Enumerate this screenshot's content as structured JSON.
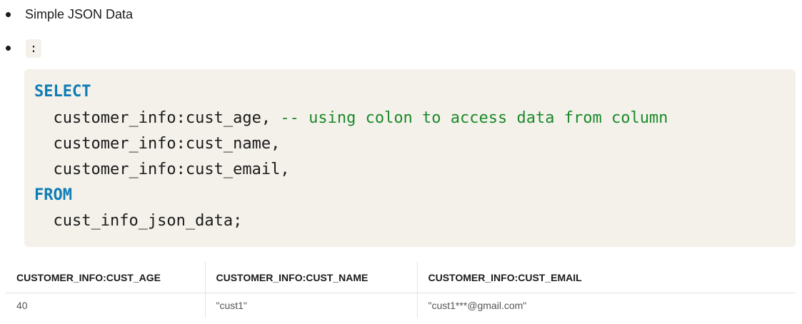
{
  "bullets": {
    "item1_text": "Simple JSON Data",
    "item2_inline_code": ":"
  },
  "code": {
    "line1_keyword": "SELECT",
    "line2_code": "  customer_info:cust_age, ",
    "line2_comment": "-- using colon to access data from column",
    "line3_code": "  customer_info:cust_name,",
    "line4_code": "  customer_info:cust_email,",
    "line5_keyword": "FROM",
    "line6_code": "  cust_info_json_data;"
  },
  "table": {
    "headers": [
      "CUSTOMER_INFO:CUST_AGE",
      "CUSTOMER_INFO:CUST_NAME",
      "CUSTOMER_INFO:CUST_EMAIL"
    ],
    "rows": [
      [
        "40",
        "\"cust1\"",
        "\"cust1***@gmail.com\""
      ]
    ]
  },
  "colors": {
    "code_background": "#f4f1ea",
    "keyword": "#0e7cb5",
    "comment": "#1a8a2a",
    "text": "#1b1b1b",
    "cell_text": "#555555"
  }
}
